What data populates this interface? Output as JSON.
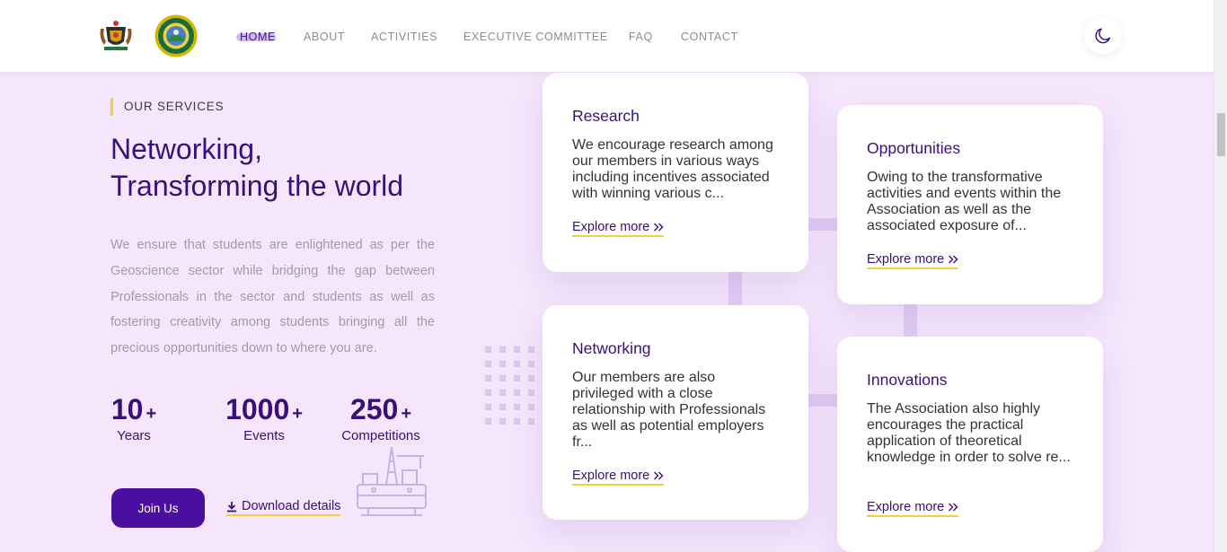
{
  "nav": {
    "links": [
      {
        "label": "HOME",
        "active": true
      },
      {
        "label": "ABOUT",
        "active": false
      },
      {
        "label": "ACTIVITIES",
        "active": false
      },
      {
        "label": "EXECUTIVE COMMITTEE",
        "active": false
      },
      {
        "label": "FAQ",
        "active": false
      },
      {
        "label": "CONTACT",
        "active": false
      }
    ],
    "theme_toggle_icon": "moon-icon",
    "logos": [
      "university-crest-logo",
      "association-seal-logo"
    ]
  },
  "hero": {
    "eyebrow": "OUR SERVICES",
    "headline_line1": "Networking,",
    "headline_line2": "Transforming the world",
    "lead": "We ensure that students are enlightened as per the Geoscience sector while bridging the gap between Professionals in the sector and students as well as fostering creativity among students bringing all the precious opportunities down to where you are.",
    "stats": [
      {
        "value": "10",
        "suffix": "+",
        "label": "Years"
      },
      {
        "value": "1000",
        "suffix": "+",
        "label": "Events"
      },
      {
        "value": "250",
        "suffix": "+",
        "label": "Competitions"
      }
    ],
    "join_button": "Join Us",
    "download_link": "Download details"
  },
  "services": [
    {
      "title": "Research",
      "text": "We encourage research among our members in various ways including incentives associated with winning various c...",
      "link": "Explore more"
    },
    {
      "title": "Opportunities",
      "text": "Owing to the transformative activities and events within the Association as well as the associated exposure of...",
      "link": "Explore more"
    },
    {
      "title": "Networking",
      "text": "Our members are also privileged with a close relationship with Professionals as well as potential employers fr...",
      "link": "Explore more"
    },
    {
      "title": "Innovations",
      "text": "The Association also highly encourages the practical application of theoretical knowledge in order to solve re...",
      "link": "Explore more"
    }
  ],
  "colors": {
    "background": "#f5e6fc",
    "primary": "#4a0fa0",
    "heading": "#3a0f78",
    "accent": "#f4d03f"
  }
}
